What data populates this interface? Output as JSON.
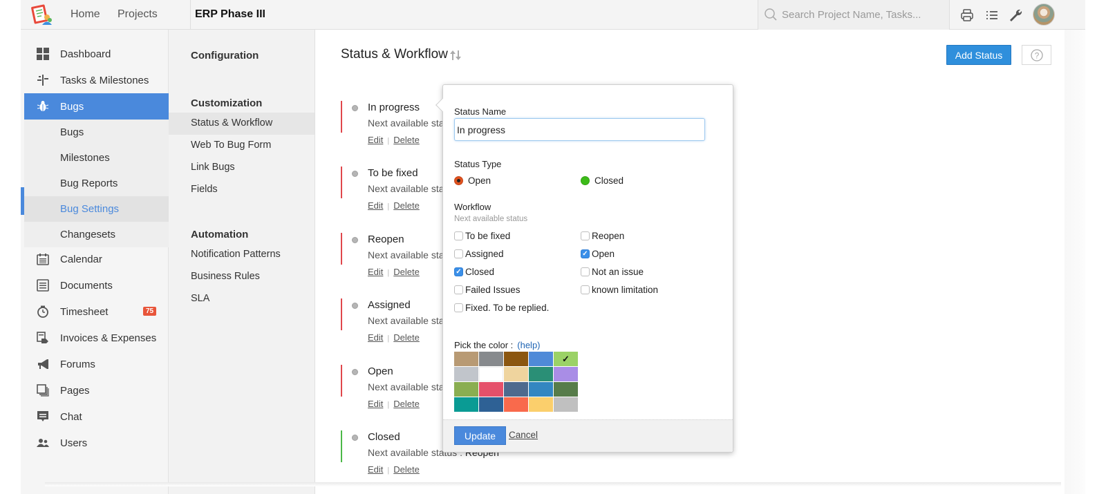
{
  "topbar": {
    "nav": [
      "Home",
      "Projects"
    ],
    "project_title": "ERP Phase III",
    "search_placeholder": "Search Project Name, Tasks...",
    "icons": [
      "print-icon",
      "list-icon",
      "wrench-icon"
    ]
  },
  "sidebar": {
    "items": [
      {
        "label": "Dashboard",
        "icon": "dashboard-icon"
      },
      {
        "label": "Tasks & Milestones",
        "icon": "tasks-icon"
      },
      {
        "label": "Bugs",
        "icon": "bug-icon",
        "active": true
      },
      {
        "label": "Calendar",
        "icon": "calendar-icon"
      },
      {
        "label": "Documents",
        "icon": "documents-icon"
      },
      {
        "label": "Timesheet",
        "icon": "timer-icon",
        "badge": "75"
      },
      {
        "label": "Invoices & Expenses",
        "icon": "invoice-icon"
      },
      {
        "label": "Forums",
        "icon": "megaphone-icon"
      },
      {
        "label": "Pages",
        "icon": "pages-icon"
      },
      {
        "label": "Chat",
        "icon": "chat-icon"
      },
      {
        "label": "Users",
        "icon": "users-icon"
      }
    ],
    "bug_sub_items": [
      "Bugs",
      "Milestones",
      "Bug Reports",
      "Bug Settings",
      "Changesets"
    ],
    "selected_sub": "Bug Settings"
  },
  "config": {
    "configuration_heading": "Configuration",
    "customization_heading": "Customization",
    "customization_items": [
      "Status & Workflow",
      "Web To Bug Form",
      "Link Bugs",
      "Fields"
    ],
    "automation_heading": "Automation",
    "automation_items": [
      "Notification Patterns",
      "Business Rules",
      "SLA"
    ]
  },
  "main": {
    "title": "Status & Workflow",
    "add_status_label": "Add Status",
    "help_icon": "?",
    "statuses": [
      {
        "name": "In progress",
        "next_label": "Next available status :",
        "next_value": "",
        "type": "open"
      },
      {
        "name": "To be fixed",
        "next_label": "Next available status :",
        "next_value": "",
        "type": "open"
      },
      {
        "name": "Reopen",
        "next_label": "Next available status :",
        "next_value": "",
        "type": "open"
      },
      {
        "name": "Assigned",
        "next_label": "Next available status :",
        "next_value": "",
        "type": "open"
      },
      {
        "name": "Open",
        "next_label": "Next available status :",
        "next_value": "",
        "type": "open"
      },
      {
        "name": "Closed",
        "next_label": "Next available status :",
        "next_value": "Reopen",
        "type": "closed"
      }
    ],
    "edit_label": "Edit",
    "delete_label": "Delete",
    "link_separator": "|"
  },
  "popover": {
    "status_name_label": "Status Name",
    "status_name_value": "In progress",
    "status_type_label": "Status Type",
    "status_types": [
      {
        "label": "Open",
        "selected": true,
        "color": "#e0531f"
      },
      {
        "label": "Closed",
        "selected": false,
        "color": "#3dbb19"
      }
    ],
    "workflow_label": "Workflow",
    "workflow_sub": "Next available status",
    "workflow_options": [
      {
        "label": "To be fixed",
        "checked": false
      },
      {
        "label": "Reopen",
        "checked": false
      },
      {
        "label": "Assigned",
        "checked": false
      },
      {
        "label": "Open",
        "checked": true
      },
      {
        "label": "Closed",
        "checked": true
      },
      {
        "label": "Not an issue",
        "checked": false
      },
      {
        "label": "Failed Issues",
        "checked": false
      },
      {
        "label": "known limitation",
        "checked": false
      },
      {
        "label": "Fixed. To be replied.",
        "checked": false
      }
    ],
    "color_label": "Pick the color :",
    "help_link": "(help)",
    "colors": [
      "#b89a74",
      "#878a8d",
      "#8b560f",
      "#4f8ad8",
      "#9bd266",
      "#c1c5cb",
      "#ffffff",
      "#efd49e",
      "#2a8f76",
      "#a98de6",
      "#8aae51",
      "#e5506a",
      "#4e6a8e",
      "#3387c1",
      "#577c4a",
      "#0a9b94",
      "#2e6195",
      "#f96a4c",
      "#fbcf6c",
      "#c0c0c0"
    ],
    "selected_color_index": 4,
    "selected_mark": "✓",
    "update_label": "Update",
    "cancel_label": "Cancel"
  }
}
